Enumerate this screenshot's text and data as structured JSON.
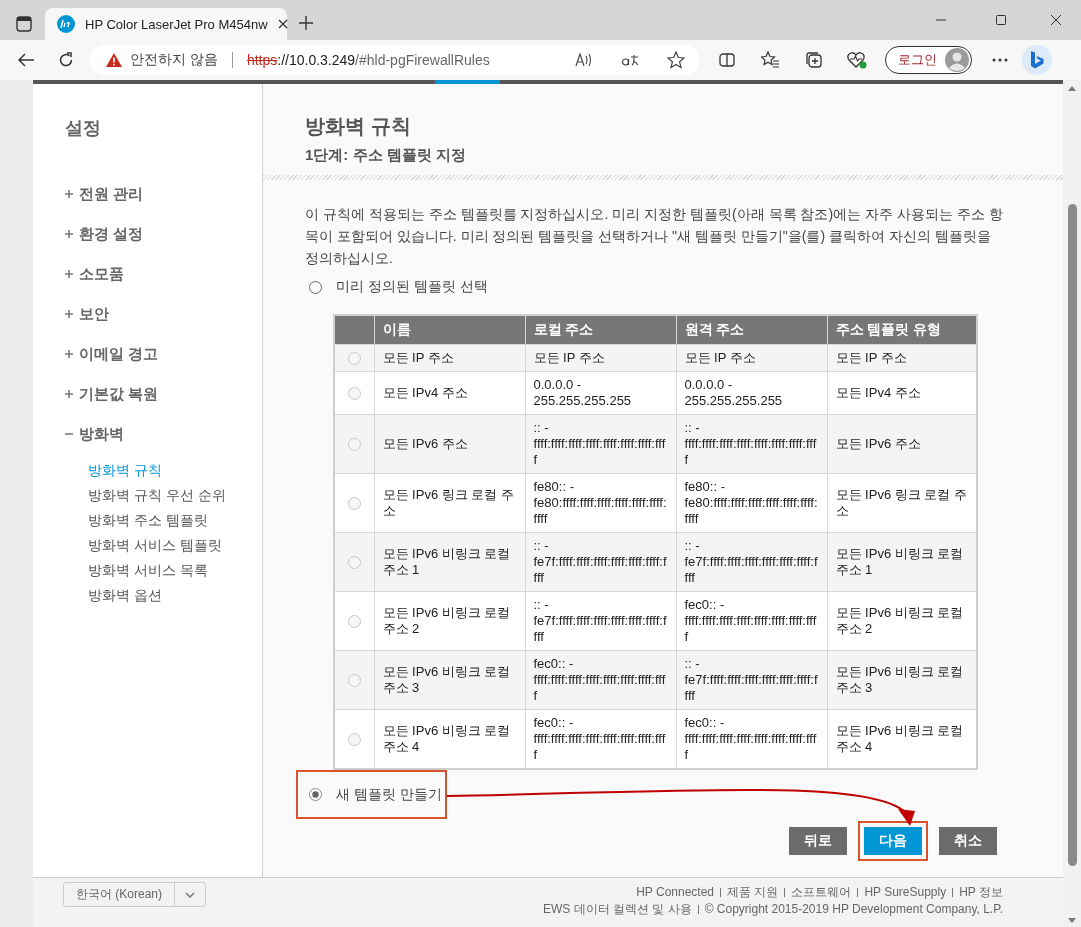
{
  "browser": {
    "tab_title": "HP Color LaserJet Pro M454nw",
    "security_label": "안전하지 않음",
    "url": {
      "scheme": "https",
      "host": "://10.0.3.249",
      "path": "/#hld-pgFirewallRules"
    },
    "profile_button": "로그인"
  },
  "sidebar": {
    "title": "설정",
    "items": [
      {
        "label": "전원 관리",
        "expanded": false
      },
      {
        "label": "환경 설정",
        "expanded": false
      },
      {
        "label": "소모품",
        "expanded": false
      },
      {
        "label": "보안",
        "expanded": false
      },
      {
        "label": "이메일 경고",
        "expanded": false
      },
      {
        "label": "기본값 복원",
        "expanded": false
      },
      {
        "label": "방화벽",
        "expanded": true,
        "children": [
          {
            "label": "방화벽 규칙",
            "selected": true
          },
          {
            "label": "방화벽 규칙 우선 순위",
            "selected": false
          },
          {
            "label": "방화벽 주소 템플릿",
            "selected": false
          },
          {
            "label": "방화벽 서비스 템플릿",
            "selected": false
          },
          {
            "label": "방화벽 서비스 목록",
            "selected": false
          },
          {
            "label": "방화벽 옵션",
            "selected": false
          }
        ]
      }
    ]
  },
  "page": {
    "title": "방화벽 규칙",
    "subtitle": "1단계: 주소 템플릿 지정",
    "description": "이 규칙에 적용되는 주소 템플릿를 지정하십시오. 미리 지정한 템플릿(아래 목록 참조)에는 자주 사용되는 주소 항목이 포함되어 있습니다. 미리 정의된 템플릿을 선택하거나 \"새 템플릿 만들기\"을(를) 클릭하여 자신의 템플릿을 정의하십시오.",
    "options": [
      {
        "label": "미리 정의된 템플릿 선택",
        "selected": false,
        "highlighted": false
      },
      {
        "label": "새 템플릿 만들기",
        "selected": true,
        "highlighted": true
      }
    ],
    "table": {
      "columns": [
        "이름",
        "로컬 주소",
        "원격 주소",
        "주소 템플릿 유형"
      ],
      "rows": [
        {
          "selected": false,
          "name": "모든 IP 주소",
          "local": "모든 IP 주소",
          "remote": "모든 IP 주소",
          "type": "모든 IP 주소"
        },
        {
          "selected": false,
          "name": "모든 IPv4 주소",
          "local": "0.0.0.0 - 255.255.255.255",
          "remote": "0.0.0.0 - 255.255.255.255",
          "type": "모든 IPv4 주소"
        },
        {
          "selected": false,
          "name": "모든 IPv6 주소",
          "local": ":: - ffff:ffff:ffff:ffff:ffff:ffff:ffff:ffff",
          "remote": ":: - ffff:ffff:ffff:ffff:ffff:ffff:ffff:ffff",
          "type": "모든 IPv6 주소"
        },
        {
          "selected": false,
          "name": "모든 IPv6 링크 로컬 주소",
          "local": "fe80:: - fe80:ffff:ffff:ffff:ffff:ffff:ffff:ffff",
          "remote": "fe80:: - fe80:ffff:ffff:ffff:ffff:ffff:ffff:ffff",
          "type": "모든 IPv6 링크 로컬 주소"
        },
        {
          "selected": false,
          "name": "모든 IPv6 비링크 로컬 주소 1",
          "local": ":: - fe7f:ffff:ffff:ffff:ffff:ffff:ffff:ffff",
          "remote": ":: - fe7f:ffff:ffff:ffff:ffff:ffff:ffff:ffff",
          "type": "모든 IPv6 비링크 로컬 주소 1"
        },
        {
          "selected": false,
          "name": "모든 IPv6 비링크 로컬 주소 2",
          "local": ":: - fe7f:ffff:ffff:ffff:ffff:ffff:ffff:ffff",
          "remote": "fec0:: - ffff:ffff:ffff:ffff:ffff:ffff:ffff:ffff",
          "type": "모든 IPv6 비링크 로컬 주소 2"
        },
        {
          "selected": false,
          "name": "모든 IPv6 비링크 로컬 주소 3",
          "local": "fec0:: - ffff:ffff:ffff:ffff:ffff:ffff:ffff:ffff",
          "remote": ":: - fe7f:ffff:ffff:ffff:ffff:ffff:ffff:ffff",
          "type": "모든 IPv6 비링크 로컬 주소 3"
        },
        {
          "selected": false,
          "name": "모든 IPv6 비링크 로컬 주소 4",
          "local": "fec0:: - ffff:ffff:ffff:ffff:ffff:ffff:ffff:ffff",
          "remote": "fec0:: - ffff:ffff:ffff:ffff:ffff:ffff:ffff:ffff",
          "type": "모든 IPv6 비링크 로컬 주소 4"
        }
      ]
    },
    "buttons": [
      {
        "label": "뒤로",
        "kind": "secondary",
        "highlighted": false
      },
      {
        "label": "다음",
        "kind": "primary",
        "highlighted": true
      },
      {
        "label": "취소",
        "kind": "secondary",
        "highlighted": false
      }
    ],
    "annotation_arrow": true
  },
  "footer": {
    "language": "한국어 (Korean)",
    "links": [
      "HP Connected",
      "제품 지원",
      "소프트웨어",
      "HP SureSupply",
      "HP 정보"
    ],
    "links_2": [
      "EWS 데이터 컬렉션 및 사용"
    ],
    "copyright": "© Copyright 2015-2019 HP Development Company, L.P."
  }
}
